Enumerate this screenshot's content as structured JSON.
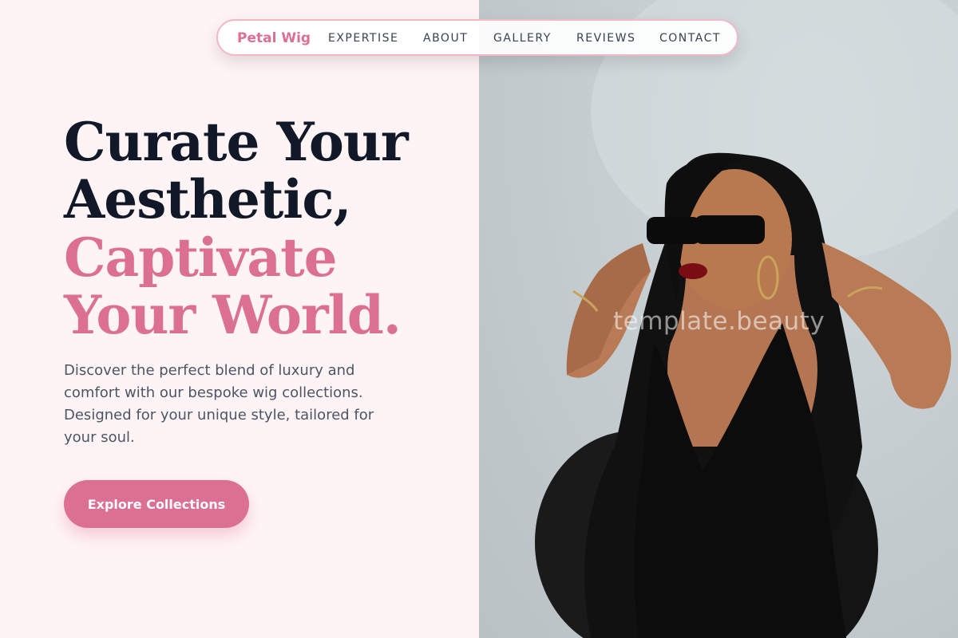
{
  "nav": {
    "brand": "Petal Wig",
    "links": [
      "EXPERTISE",
      "ABOUT",
      "GALLERY",
      "REVIEWS",
      "CONTACT"
    ]
  },
  "hero": {
    "headline_lines": [
      "Curate Your",
      "Aesthetic,"
    ],
    "accent_lines": [
      "Captivate",
      "Your World."
    ],
    "description": "Discover the perfect blend of luxury and comfort with our bespoke wig collections. Designed for your unique style, tailored for your soul.",
    "cta_label": "Explore Collections"
  },
  "image": {
    "watermark": "template.beauty"
  },
  "colors": {
    "accent": "#db7093",
    "heading": "#111827",
    "body_text": "#4b5563",
    "left_background": "#fff4f5",
    "nav_border": "#f2b8c6"
  }
}
